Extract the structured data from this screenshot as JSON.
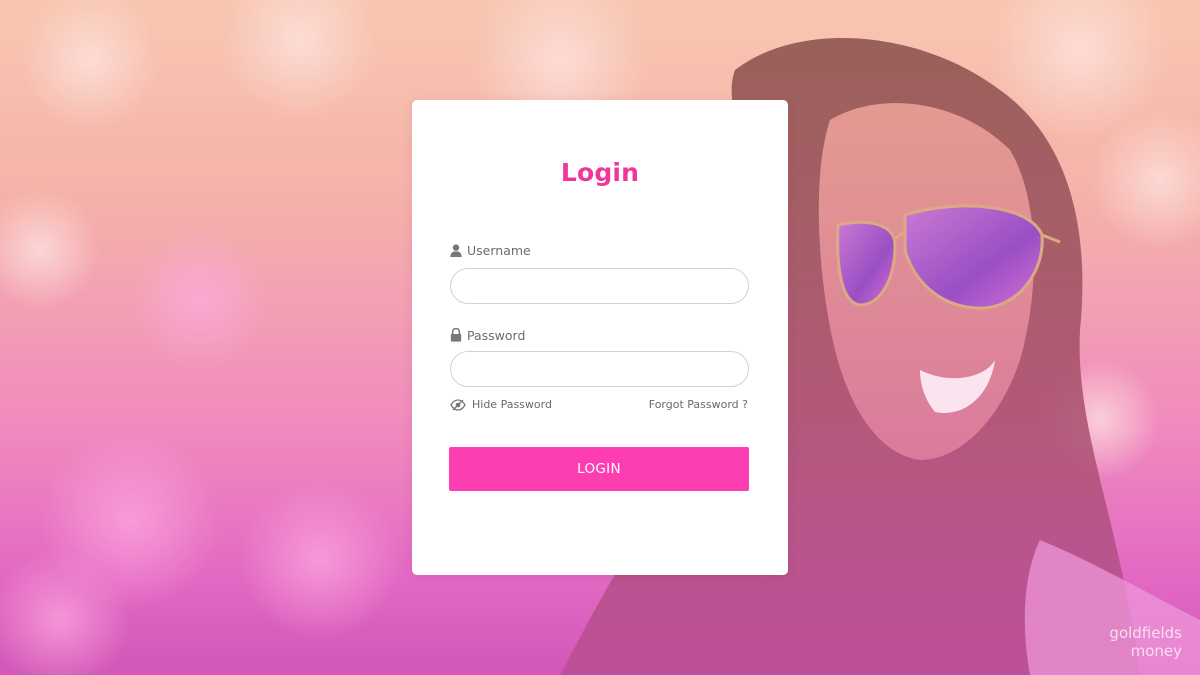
{
  "login": {
    "title": "Login",
    "username_label": "Username",
    "username_value": "",
    "password_label": "Password",
    "password_value": "",
    "hide_password_label": "Hide Password",
    "forgot_password_label": "Forgot Password ?",
    "login_button_label": "LOGIN"
  },
  "brand": {
    "line1": "goldfields",
    "line2": "money"
  },
  "icons": {
    "username": "user-icon",
    "password": "lock-icon",
    "hide_password": "eye-slash-icon"
  },
  "colors": {
    "accent": "#f0359c",
    "button": "#fc3eb1",
    "input_border": "#d2d2d2",
    "label_text": "#6d6d6d",
    "background_top": "#f8d2ae",
    "background_bottom": "#cc52b6"
  }
}
